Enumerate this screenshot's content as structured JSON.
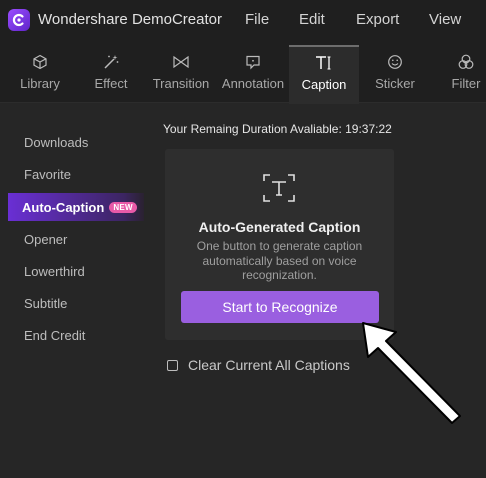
{
  "app": {
    "title": "Wondershare DemoCreator"
  },
  "menu": [
    "File",
    "Edit",
    "Export",
    "View"
  ],
  "tabs": [
    {
      "label": "Library",
      "icon": "cube-icon"
    },
    {
      "label": "Effect",
      "icon": "magic-wand-icon"
    },
    {
      "label": "Transition",
      "icon": "transition-icon"
    },
    {
      "label": "Annotation",
      "icon": "annotation-icon"
    },
    {
      "label": "Caption",
      "icon": "caption-icon",
      "active": true
    },
    {
      "label": "Sticker",
      "icon": "smiley-icon"
    },
    {
      "label": "Filter",
      "icon": "filter-icon"
    }
  ],
  "sidebar": {
    "items": [
      {
        "label": "Downloads"
      },
      {
        "label": "Favorite"
      },
      {
        "label": "Auto-Caption",
        "badge": "NEW",
        "active": true
      },
      {
        "label": "Opener"
      },
      {
        "label": "Lowerthird"
      },
      {
        "label": "Subtitle"
      },
      {
        "label": "End Credit"
      }
    ]
  },
  "main": {
    "remaining": "Your Remaing Duration Avaliable: 19:37:22",
    "card": {
      "icon": "text-frame-icon",
      "title": "Auto-Generated Caption",
      "description": "One button to generate caption automatically based on voice recognization.",
      "button_label": "Start to Recognize"
    },
    "clear_label": "Clear Current All Captions",
    "clear_checked": false
  },
  "colors": {
    "accent": "#9a5fe0",
    "active_gradient_start": "#6a2fd4",
    "badge": "#e85aa8",
    "background": "#262626",
    "bar": "#1f1f1f"
  }
}
